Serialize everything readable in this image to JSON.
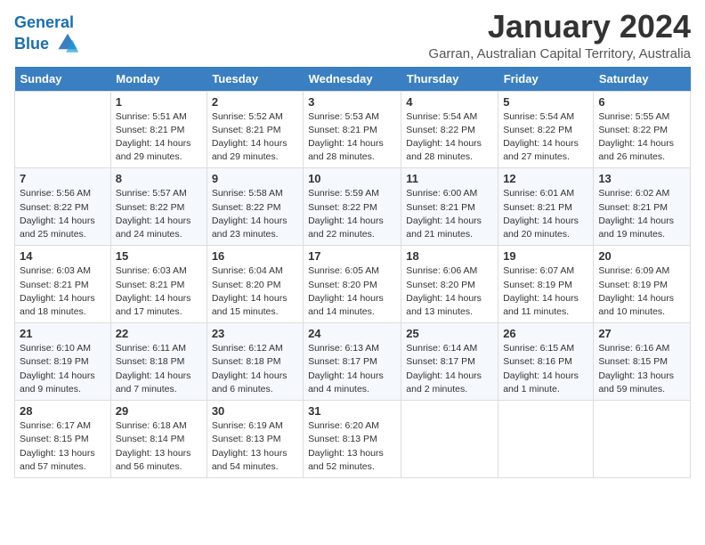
{
  "logo": {
    "line1": "General",
    "line2": "Blue"
  },
  "title": "January 2024",
  "location": "Garran, Australian Capital Territory, Australia",
  "days_header": [
    "Sunday",
    "Monday",
    "Tuesday",
    "Wednesday",
    "Thursday",
    "Friday",
    "Saturday"
  ],
  "weeks": [
    [
      {
        "day": "",
        "text": ""
      },
      {
        "day": "1",
        "text": "Sunrise: 5:51 AM\nSunset: 8:21 PM\nDaylight: 14 hours\nand 29 minutes."
      },
      {
        "day": "2",
        "text": "Sunrise: 5:52 AM\nSunset: 8:21 PM\nDaylight: 14 hours\nand 29 minutes."
      },
      {
        "day": "3",
        "text": "Sunrise: 5:53 AM\nSunset: 8:21 PM\nDaylight: 14 hours\nand 28 minutes."
      },
      {
        "day": "4",
        "text": "Sunrise: 5:54 AM\nSunset: 8:22 PM\nDaylight: 14 hours\nand 28 minutes."
      },
      {
        "day": "5",
        "text": "Sunrise: 5:54 AM\nSunset: 8:22 PM\nDaylight: 14 hours\nand 27 minutes."
      },
      {
        "day": "6",
        "text": "Sunrise: 5:55 AM\nSunset: 8:22 PM\nDaylight: 14 hours\nand 26 minutes."
      }
    ],
    [
      {
        "day": "7",
        "text": "Sunrise: 5:56 AM\nSunset: 8:22 PM\nDaylight: 14 hours\nand 25 minutes."
      },
      {
        "day": "8",
        "text": "Sunrise: 5:57 AM\nSunset: 8:22 PM\nDaylight: 14 hours\nand 24 minutes."
      },
      {
        "day": "9",
        "text": "Sunrise: 5:58 AM\nSunset: 8:22 PM\nDaylight: 14 hours\nand 23 minutes."
      },
      {
        "day": "10",
        "text": "Sunrise: 5:59 AM\nSunset: 8:22 PM\nDaylight: 14 hours\nand 22 minutes."
      },
      {
        "day": "11",
        "text": "Sunrise: 6:00 AM\nSunset: 8:21 PM\nDaylight: 14 hours\nand 21 minutes."
      },
      {
        "day": "12",
        "text": "Sunrise: 6:01 AM\nSunset: 8:21 PM\nDaylight: 14 hours\nand 20 minutes."
      },
      {
        "day": "13",
        "text": "Sunrise: 6:02 AM\nSunset: 8:21 PM\nDaylight: 14 hours\nand 19 minutes."
      }
    ],
    [
      {
        "day": "14",
        "text": "Sunrise: 6:03 AM\nSunset: 8:21 PM\nDaylight: 14 hours\nand 18 minutes."
      },
      {
        "day": "15",
        "text": "Sunrise: 6:03 AM\nSunset: 8:21 PM\nDaylight: 14 hours\nand 17 minutes."
      },
      {
        "day": "16",
        "text": "Sunrise: 6:04 AM\nSunset: 8:20 PM\nDaylight: 14 hours\nand 15 minutes."
      },
      {
        "day": "17",
        "text": "Sunrise: 6:05 AM\nSunset: 8:20 PM\nDaylight: 14 hours\nand 14 minutes."
      },
      {
        "day": "18",
        "text": "Sunrise: 6:06 AM\nSunset: 8:20 PM\nDaylight: 14 hours\nand 13 minutes."
      },
      {
        "day": "19",
        "text": "Sunrise: 6:07 AM\nSunset: 8:19 PM\nDaylight: 14 hours\nand 11 minutes."
      },
      {
        "day": "20",
        "text": "Sunrise: 6:09 AM\nSunset: 8:19 PM\nDaylight: 14 hours\nand 10 minutes."
      }
    ],
    [
      {
        "day": "21",
        "text": "Sunrise: 6:10 AM\nSunset: 8:19 PM\nDaylight: 14 hours\nand 9 minutes."
      },
      {
        "day": "22",
        "text": "Sunrise: 6:11 AM\nSunset: 8:18 PM\nDaylight: 14 hours\nand 7 minutes."
      },
      {
        "day": "23",
        "text": "Sunrise: 6:12 AM\nSunset: 8:18 PM\nDaylight: 14 hours\nand 6 minutes."
      },
      {
        "day": "24",
        "text": "Sunrise: 6:13 AM\nSunset: 8:17 PM\nDaylight: 14 hours\nand 4 minutes."
      },
      {
        "day": "25",
        "text": "Sunrise: 6:14 AM\nSunset: 8:17 PM\nDaylight: 14 hours\nand 2 minutes."
      },
      {
        "day": "26",
        "text": "Sunrise: 6:15 AM\nSunset: 8:16 PM\nDaylight: 14 hours\nand 1 minute."
      },
      {
        "day": "27",
        "text": "Sunrise: 6:16 AM\nSunset: 8:15 PM\nDaylight: 13 hours\nand 59 minutes."
      }
    ],
    [
      {
        "day": "28",
        "text": "Sunrise: 6:17 AM\nSunset: 8:15 PM\nDaylight: 13 hours\nand 57 minutes."
      },
      {
        "day": "29",
        "text": "Sunrise: 6:18 AM\nSunset: 8:14 PM\nDaylight: 13 hours\nand 56 minutes."
      },
      {
        "day": "30",
        "text": "Sunrise: 6:19 AM\nSunset: 8:13 PM\nDaylight: 13 hours\nand 54 minutes."
      },
      {
        "day": "31",
        "text": "Sunrise: 6:20 AM\nSunset: 8:13 PM\nDaylight: 13 hours\nand 52 minutes."
      },
      {
        "day": "",
        "text": ""
      },
      {
        "day": "",
        "text": ""
      },
      {
        "day": "",
        "text": ""
      }
    ]
  ]
}
